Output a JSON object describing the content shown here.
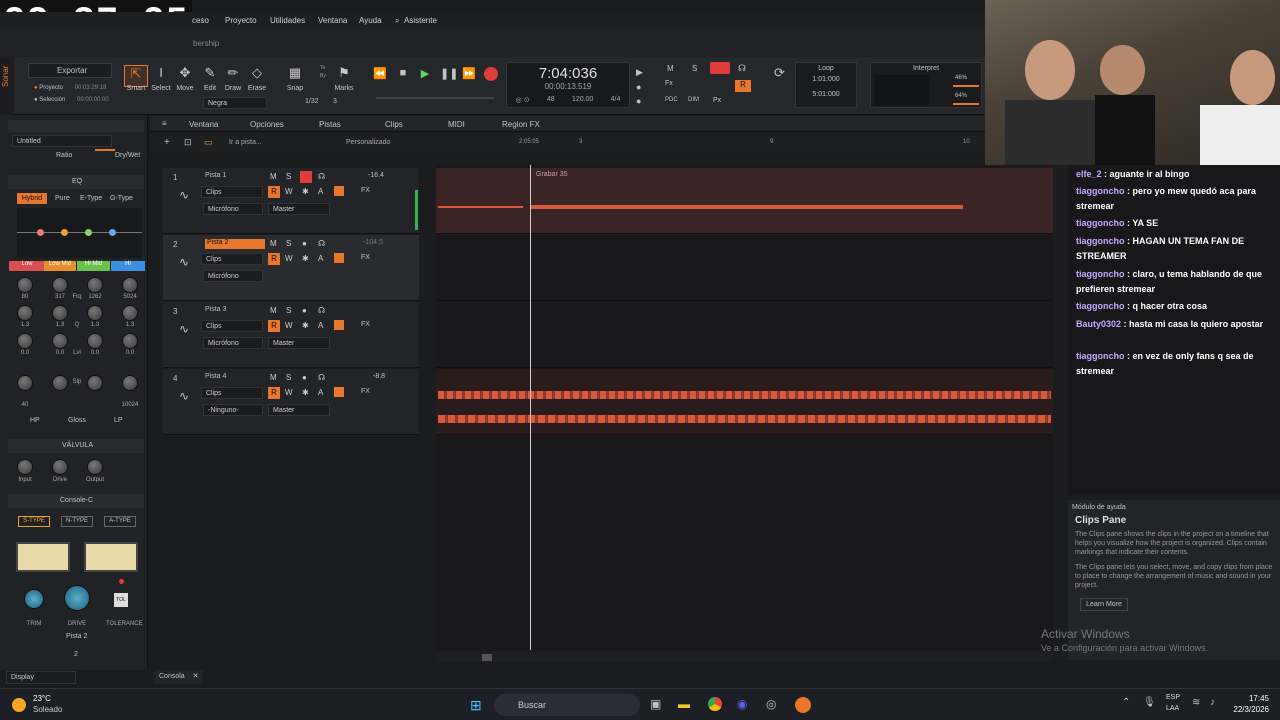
{
  "stream_clock": "22:37:25",
  "menu": [
    "ceso",
    "Proyecto",
    "Utilidades",
    "Ventana",
    "Ayuda",
    "Asistente"
  ],
  "subbar_text": "bership",
  "sonar": "Sonar",
  "export": {
    "label": "Exportar",
    "proyecto": "Proyecto",
    "proyecto_time": "00:03:29:18",
    "seleccion": "Selección",
    "seleccion_time": "00:00:00:00"
  },
  "tools": [
    "Smart",
    "Select",
    "Move",
    "Edit",
    "Draw",
    "Erase"
  ],
  "snap": {
    "label": "Snap",
    "to": "To",
    "by": "By",
    "marks": "Marks",
    "value": "1/32",
    "num": "3",
    "mode": "Negra"
  },
  "transport": {
    "time": "7:04:036",
    "smpte": "00:00:13.519",
    "tempo": "120.00",
    "meter": "4/4",
    "t1": "48",
    "t2": "96"
  },
  "loop": {
    "label": "Loop",
    "start": "1:01:000",
    "end": "5:01:000"
  },
  "interpret": {
    "label": "Interpret",
    "p1": "46%",
    "p2": "64%"
  },
  "view_menu": [
    "Ventana",
    "Opciones",
    "Pistas",
    "Clips",
    "MIDI",
    "Region FX"
  ],
  "goto": "Ir a pista...",
  "custom": "Personalizado",
  "ruler": [
    "2:05:05",
    "3",
    "9",
    "10"
  ],
  "inspector": {
    "untitled": "Untitled",
    "ratio": "Ratio",
    "drywet": "Dry/Wet",
    "eq": {
      "title": "EQ",
      "modes": [
        "Hybrid",
        "Pure",
        "E-Type",
        "G-Type"
      ],
      "bands": [
        "Low",
        "Low Mid",
        "Hi Mid",
        "Hi"
      ],
      "freq": [
        "80",
        "317",
        "1262",
        "5024"
      ],
      "q": [
        "1.3",
        "1.3",
        "1.3",
        "1.3"
      ],
      "lvl": [
        "0.0",
        "0.0",
        "0.0",
        "0.0"
      ],
      "frq_label": "Frq",
      "q_label": "Q",
      "lvl_label": "Lvl",
      "slp_label": "Slp",
      "hp": "40",
      "lp": "10024",
      "foot": [
        "HP",
        "Gloss",
        "LP"
      ]
    },
    "valvula": {
      "title": "VÁLVULA",
      "knobs": [
        "Input",
        "Drive",
        "Output"
      ]
    },
    "console": {
      "title": "Console-C",
      "types": [
        "S-TYPE",
        "N-TYPE",
        "A-TYPE"
      ],
      "knobs": [
        "TRIM",
        "DRIVE",
        "TOLERANCE"
      ],
      "tol": "TOL",
      "track": "Pista 2",
      "num": "2"
    },
    "display": "Display"
  },
  "tracks": [
    {
      "num": "1",
      "name": "Pista 1",
      "type": "Clips",
      "input": "Micrófono",
      "out": "Master",
      "vol": "-16.4",
      "fx": "FX"
    },
    {
      "num": "2",
      "name": "Pista 2",
      "type": "Clips",
      "input": "Micrófono",
      "out": "Master",
      "vol": "-104.5",
      "fx": "FX"
    },
    {
      "num": "3",
      "name": "Pista 3",
      "type": "Clips",
      "input": "Micrófono",
      "out": "Master",
      "vol": "",
      "fx": "FX"
    },
    {
      "num": "4",
      "name": "Pista 4",
      "type": "Clips",
      "input": "-Ninguno-",
      "out": "Master",
      "vol": "-8.8",
      "fx": "FX"
    }
  ],
  "clip_label": "Grabar 35",
  "console_tab": "Consola",
  "chat": [
    {
      "user": "elfe_2",
      "msg": "aguante ir al bingo"
    },
    {
      "user": "tiaggoncho",
      "msg": "pero yo mew quedó aca para stremear"
    },
    {
      "user": "tiaggoncho",
      "msg": "YA SE"
    },
    {
      "user": "tiaggoncho",
      "msg": "HAGAN UN TEMA FAN DE STREAMER"
    },
    {
      "user": "tiaggoncho",
      "msg": "claro, u tema hablando de que prefieren stremear"
    },
    {
      "user": "tiaggoncho",
      "msg": "q hacer otra cosa"
    },
    {
      "user": "Bauty0302",
      "msg": "hasta mi casa la quiero apostar"
    },
    {
      "user": "tiaggoncho",
      "msg": "en vez de only fans q sea de stremear"
    }
  ],
  "help": {
    "header": "Módulo de ayuda",
    "title": "Clips Pane",
    "p1": "The Clips pane shows the clips in the project on a timeline that helps you visualize how the project is organized. Clips contain markings that indicate their contents.",
    "p2": "The Clips pane lets you select, move, and copy clips from place to place to change the arrangement of music and sound in your project.",
    "learn": "Learn More"
  },
  "watermark": {
    "line1": "Activar Windows",
    "line2": "Ve a Configuración para activar Windows."
  },
  "taskbar": {
    "temp": "23°C",
    "weather": "Soleado",
    "search": "Buscar",
    "lang1": "ESP",
    "lang2": "LAA",
    "time": "17:45",
    "date": "22/3/2026"
  }
}
